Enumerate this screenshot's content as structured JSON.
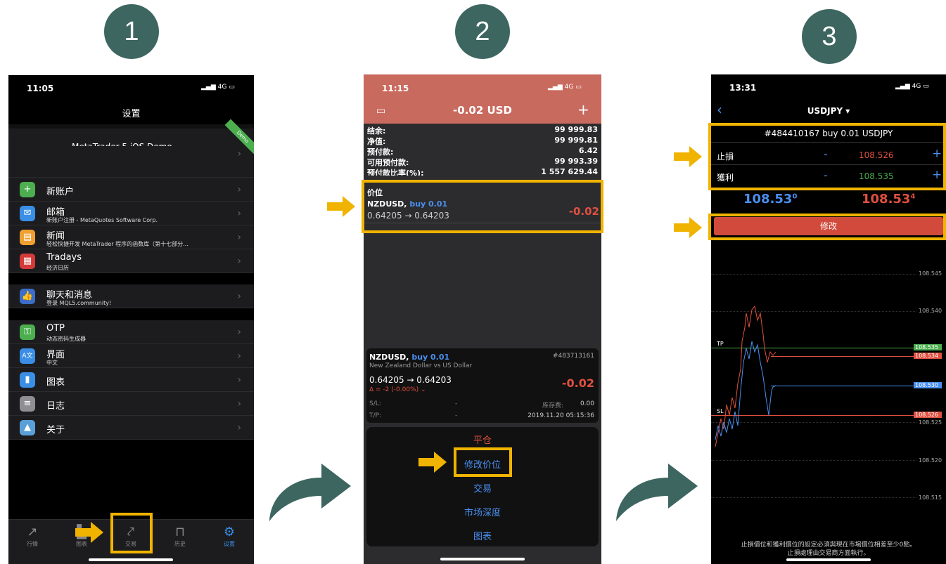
{
  "steps": [
    "1",
    "2",
    "3"
  ],
  "phone1": {
    "time": "11:05",
    "signal": "4G",
    "title": "设置",
    "account_name": "MetaTrader 5 iOS Demo",
    "demo_ribbon": "Demo",
    "items": [
      {
        "icon": "new-account-icon",
        "title": "新账户",
        "subtitle": ""
      },
      {
        "icon": "mailbox-icon",
        "title": "邮箱",
        "subtitle": "新账户注册 - MetaQuotes Software Corp."
      },
      {
        "icon": "news-icon",
        "title": "新闻",
        "subtitle": "轻松快捷开发 MetaTrader 程序的函数库（第十七部分..."
      },
      {
        "icon": "tradays-icon",
        "title": "Tradays",
        "subtitle": "经济日历"
      },
      {
        "icon": "chat-icon",
        "title": "聊天和消息",
        "subtitle": "登录 MQL5.community!"
      },
      {
        "icon": "otp-key-icon",
        "title": "OTP",
        "subtitle": "动态密码生成器"
      },
      {
        "icon": "interface-language-icon",
        "title": "界面",
        "subtitle": "中文"
      },
      {
        "icon": "charts-icon",
        "title": "图表",
        "subtitle": ""
      },
      {
        "icon": "journal-icon",
        "title": "日志",
        "subtitle": ""
      },
      {
        "icon": "about-icon",
        "title": "关于",
        "subtitle": ""
      }
    ],
    "tabs": [
      "行情",
      "图表",
      "交易",
      "历史",
      "设置"
    ]
  },
  "phone2": {
    "time": "11:15",
    "signal": "4G",
    "header_value": "-0.02 USD",
    "add_glyph": "+",
    "account": [
      {
        "label": "结余:",
        "value": "99 999.83"
      },
      {
        "label": "净值:",
        "value": "99 999.81"
      },
      {
        "label": "预付款:",
        "value": "6.42"
      },
      {
        "label": "可用预付款:",
        "value": "99 993.39"
      },
      {
        "label": "预付款比率(%):",
        "value": "1 557 629.44"
      }
    ],
    "positions_header": "价位",
    "position": {
      "symbol": "NZDUSD,",
      "side": "buy 0.01",
      "prices": "0.64205 → 0.64203",
      "profit": "-0.02"
    },
    "card": {
      "symbol": "NZDUSD,",
      "side": "buy 0.01",
      "ticket": "#483713161",
      "description": "New Zealand Dollar vs US Dollar",
      "prices": "0.64205 → 0.64203",
      "delta": "Δ = -2 (-0.00%)",
      "profit": "-0.02",
      "sl_label": "S/L:",
      "sl_value": "-",
      "tp_label": "T/P:",
      "tp_value": "-",
      "swap_label": "库存费:",
      "swap_value": "0.00",
      "datetime": "2019.11.20 05:15:36"
    },
    "menu": [
      "平仓",
      "修改价位",
      "交易",
      "市场深度",
      "图表"
    ]
  },
  "phone3": {
    "time": "13:31",
    "signal": "4G",
    "symbol": "USDJPY",
    "order_title": "#484410167 buy 0.01 USDJPY",
    "stop_loss_label": "止損",
    "stop_loss_value": "108.526",
    "take_profit_label": "獲利",
    "take_profit_value": "108.535",
    "minus": "-",
    "plus": "+",
    "bid_main": "108.53",
    "bid_sup": "0",
    "ask_main": "108.53",
    "ask_sup": "4",
    "modify_button": "修改",
    "price_levels": [
      "108.545",
      "108.540",
      "108.535",
      "108.534",
      "108.530",
      "108.526",
      "108.525",
      "108.520",
      "108.515"
    ],
    "tp_marker": "TP",
    "sl_marker": "SL",
    "footer_line1": "止損價位和獲利價位的設定必須與現在市場價位相差至少0點。",
    "footer_line2": "止損處理由交易商方面執行。"
  },
  "colors": {
    "step_circle": "#3d6660",
    "highlight": "#f0b400",
    "phone2_header": "#c96a5f",
    "loss_red": "#e05040",
    "link_blue": "#4a8ff0",
    "tp_green": "#4cae4f"
  }
}
